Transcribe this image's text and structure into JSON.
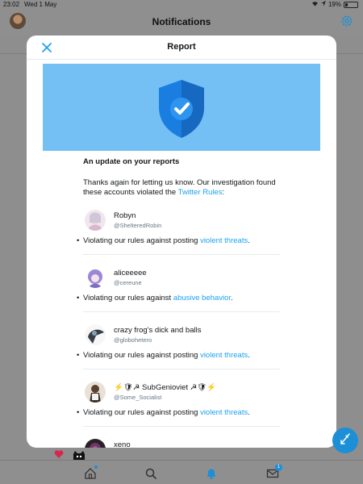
{
  "status_bar": {
    "time": "23:02",
    "date": "Wed 1 May",
    "battery": "19%"
  },
  "header": {
    "title": "Notifications"
  },
  "modal": {
    "title": "Report",
    "update_heading": "An update on your reports",
    "thanks_text": "Thanks again for letting us know. Our investigation found these accounts violated the ",
    "rules_link": "Twitter Rules",
    "thanks_suffix": ":",
    "accounts": [
      {
        "name": "Robyn",
        "handle": "@ShelteredRobin",
        "violation_prefix": "Violating our rules against posting ",
        "violation_link": "violent threats",
        "violation_suffix": "."
      },
      {
        "name": "aliceeeee",
        "handle": "@cereune",
        "violation_prefix": "Violating our rules against ",
        "violation_link": "abusive behavior",
        "violation_suffix": "."
      },
      {
        "name": "crazy frog's dick and balls",
        "handle": "@globohetero",
        "violation_prefix": "Violating our rules against posting ",
        "violation_link": "violent threats",
        "violation_suffix": "."
      },
      {
        "name": "⚡🛡☭ SubGenioviet ☭🛡⚡",
        "handle": "@Some_Socialist",
        "violation_prefix": "Violating our rules against posting ",
        "violation_link": "violent threats",
        "violation_suffix": "."
      },
      {
        "name": "xeno",
        "handle": "",
        "violation_prefix": "",
        "violation_link": "",
        "violation_suffix": ""
      }
    ]
  },
  "tabbar": {
    "messages_badge": "1"
  },
  "colors": {
    "accent": "#1da1f2",
    "banner": "#74c0f5",
    "shield": "#1a7ee0"
  },
  "icons": [
    "close-icon",
    "shield-check-icon",
    "gear-icon",
    "home-icon",
    "search-icon",
    "bell-icon",
    "mail-icon",
    "compose-icon",
    "heart-icon",
    "cat-icon"
  ]
}
